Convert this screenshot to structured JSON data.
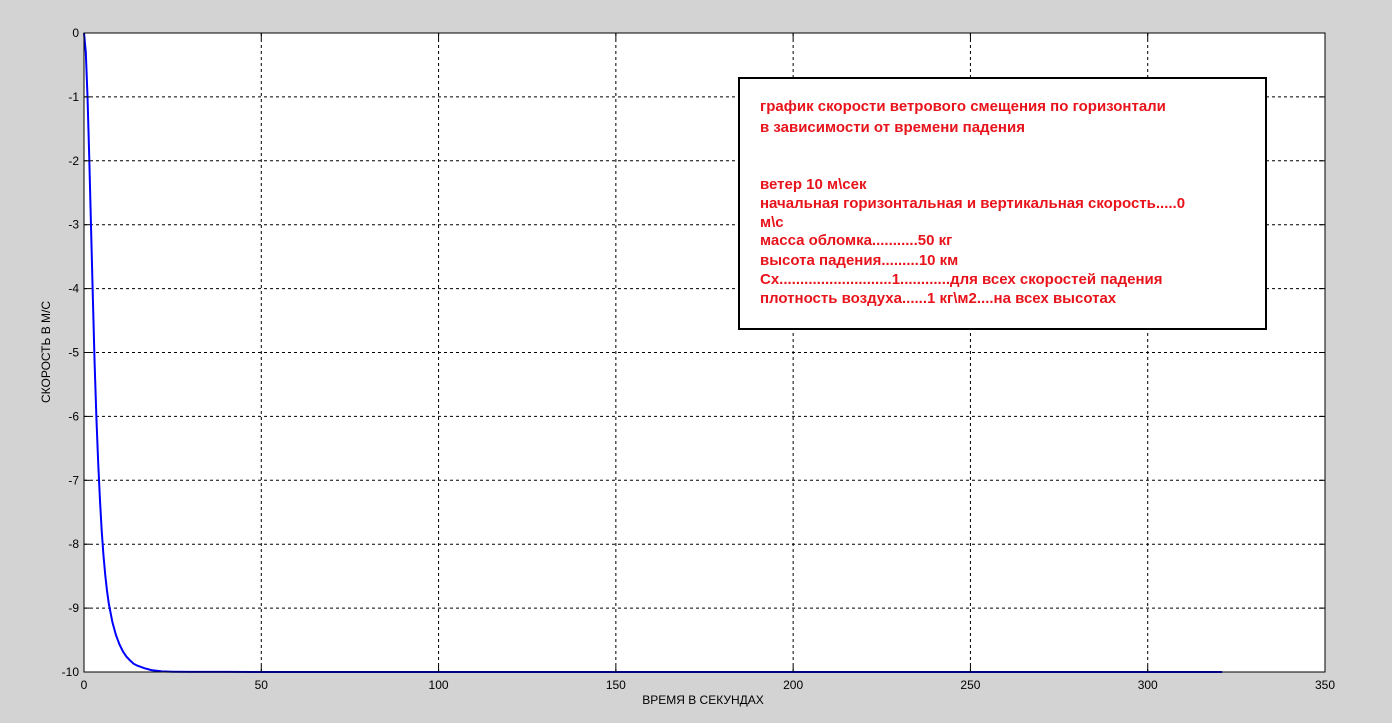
{
  "chart_data": {
    "type": "line",
    "xlabel": "ВРЕМЯ В СЕКУНДАХ",
    "ylabel": "СКОРОСТЬ В М/С",
    "xlim": [
      0,
      350
    ],
    "ylim": [
      -10,
      0
    ],
    "x_ticks": [
      0,
      50,
      100,
      150,
      200,
      250,
      300,
      350
    ],
    "y_ticks": [
      0,
      -1,
      -2,
      -3,
      -4,
      -5,
      -6,
      -7,
      -8,
      -9,
      -10
    ],
    "x_tick_labels": [
      "0",
      "50",
      "100",
      "150",
      "200",
      "250",
      "300",
      "350"
    ],
    "y_tick_labels": [
      "0",
      "-1",
      "-2",
      "-3",
      "-4",
      "-5",
      "-6",
      "-7",
      "-8",
      "-9",
      "-10"
    ],
    "grid": true,
    "series": [
      {
        "color": "#0000ff",
        "x": [
          0,
          0.5,
          1,
          1.5,
          2,
          2.5,
          3,
          3.5,
          4,
          4.5,
          5,
          5.5,
          6,
          6.5,
          7,
          8,
          9,
          10,
          11,
          12,
          13,
          14,
          15,
          17,
          19,
          22,
          25,
          30,
          40,
          60,
          100,
          150,
          200,
          250,
          300,
          321
        ],
        "y": [
          0,
          -0.3,
          -0.99,
          -1.98,
          -3.08,
          -4.17,
          -5.16,
          -6.02,
          -6.73,
          -7.32,
          -7.79,
          -8.18,
          -8.49,
          -8.73,
          -8.93,
          -9.22,
          -9.42,
          -9.57,
          -9.68,
          -9.76,
          -9.82,
          -9.87,
          -9.9,
          -9.94,
          -9.97,
          -9.99,
          -9.995,
          -9.998,
          -9.999,
          -10,
          -10,
          -10,
          -10,
          -10,
          -10,
          -10
        ]
      }
    ],
    "annotation": {
      "lines": [
        "график скорости ветрового смещения по горизонтали",
        "в зависимости от времени падения",
        "",
        "ветер 10 м\\сек",
        "начальная горизонтальная и вертикальная скорость.....0",
        "м\\с",
        "масса обломка...........50 кг",
        "высота падения.........10 км",
        "Сх...........................1............для всех скоростей падения",
        "плотность воздуха......1 кг\\м2....на всех высотах"
      ],
      "color": "#e8131b"
    }
  }
}
